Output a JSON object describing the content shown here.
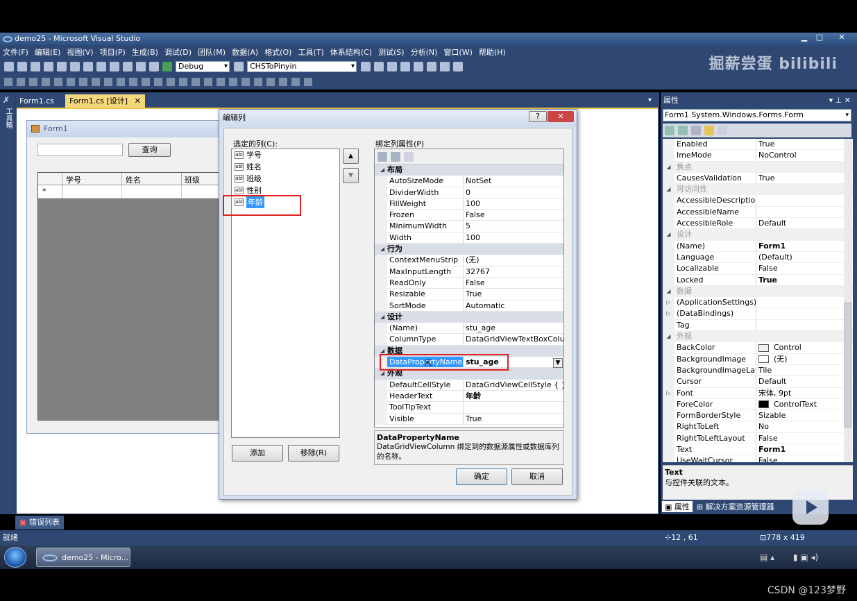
{
  "window": {
    "title": "demo25 - Microsoft Visual Studio",
    "btn_min": "▁",
    "btn_max": "□",
    "btn_close": "✕"
  },
  "menu": [
    "文件(F)",
    "编辑(E)",
    "视图(V)",
    "项目(P)",
    "生成(B)",
    "调试(D)",
    "团队(M)",
    "数据(A)",
    "格式(O)",
    "工具(T)",
    "体系结构(C)",
    "测试(S)",
    "分析(N)",
    "窗口(W)",
    "帮助(H)"
  ],
  "toolbar": {
    "config": "Debug",
    "startup": "CHSToPinyin"
  },
  "watermark": "掘薪尝蛋 bilibili",
  "left_strip": "工具箱",
  "tabs": {
    "tab1": "Form1.cs",
    "tab2": "Form1.cs [设计]",
    "close": "✕",
    "dropdown": "▾"
  },
  "form": {
    "title": "Form1",
    "query_button": "查询",
    "columns": [
      "学号",
      "姓名",
      "班级"
    ],
    "new_row": "*"
  },
  "dialog": {
    "title": "编辑列",
    "help": "?",
    "close": "✕",
    "selected_label": "选定的列(C):",
    "columns": [
      "学号",
      "姓名",
      "班级",
      "性别",
      "年龄"
    ],
    "col_icon": "abl",
    "up": "▲",
    "down": "▼",
    "bound_label": "绑定列属性(P)",
    "add_button": "添加",
    "remove_button": "移除(R)",
    "ok_button": "确定",
    "cancel_button": "取消",
    "desc_title": "DataPropertyName",
    "desc_text": "DataGridViewColumn 绑定到的数据源属性或数据库列的名称。",
    "categories": [
      {
        "name": "布局",
        "rows": [
          [
            "AutoSizeMode",
            "NotSet"
          ],
          [
            "DividerWidth",
            "0"
          ],
          [
            "FillWeight",
            "100"
          ],
          [
            "Frozen",
            "False"
          ],
          [
            "MinimumWidth",
            "5"
          ],
          [
            "Width",
            "100"
          ]
        ]
      },
      {
        "name": "行为",
        "rows": [
          [
            "ContextMenuStrip",
            "(无)"
          ],
          [
            "MaxInputLength",
            "32767"
          ],
          [
            "ReadOnly",
            "False"
          ],
          [
            "Resizable",
            "True"
          ],
          [
            "SortMode",
            "Automatic"
          ]
        ]
      },
      {
        "name": "设计",
        "rows": [
          [
            "(Name)",
            "stu_age"
          ],
          [
            "ColumnType",
            "DataGridViewTextBoxColumn"
          ]
        ]
      },
      {
        "name": "数据",
        "rows": [
          [
            "DataPropertyName",
            "stu_age"
          ]
        ]
      },
      {
        "name": "外观",
        "rows": [
          [
            "DefaultCellStyle",
            "DataGridViewCellStyle { }"
          ],
          [
            "HeaderText",
            "年龄"
          ],
          [
            "ToolTipText",
            ""
          ],
          [
            "Visible",
            "True"
          ]
        ]
      }
    ]
  },
  "properties": {
    "title": "属性",
    "pin": "▾ ⊥ ✕",
    "object": "Form1 System.Windows.Forms.Form",
    "rows": [
      {
        "t": "r",
        "n": "Enabled",
        "v": "True"
      },
      {
        "t": "r",
        "n": "ImeMode",
        "v": "NoControl"
      },
      {
        "t": "c",
        "n": "焦点"
      },
      {
        "t": "r",
        "n": "CausesValidation",
        "v": "True"
      },
      {
        "t": "c",
        "n": "可访问性"
      },
      {
        "t": "r",
        "n": "AccessibleDescription",
        "v": ""
      },
      {
        "t": "r",
        "n": "AccessibleName",
        "v": ""
      },
      {
        "t": "r",
        "n": "AccessibleRole",
        "v": "Default"
      },
      {
        "t": "c",
        "n": "设计"
      },
      {
        "t": "r",
        "n": "(Name)",
        "v": "Form1",
        "b": true
      },
      {
        "t": "r",
        "n": "Language",
        "v": "(Default)"
      },
      {
        "t": "r",
        "n": "Localizable",
        "v": "False"
      },
      {
        "t": "r",
        "n": "Locked",
        "v": "True",
        "b": true
      },
      {
        "t": "c",
        "n": "数据"
      },
      {
        "t": "e",
        "n": "(ApplicationSettings)",
        "v": ""
      },
      {
        "t": "e",
        "n": "(DataBindings)",
        "v": ""
      },
      {
        "t": "r",
        "n": "Tag",
        "v": ""
      },
      {
        "t": "c",
        "n": "外观"
      },
      {
        "t": "r",
        "n": "BackColor",
        "v": "Control",
        "sw": "#f0f0f0"
      },
      {
        "t": "r",
        "n": "BackgroundImage",
        "v": "(无)",
        "sw": "#ffffff"
      },
      {
        "t": "r",
        "n": "BackgroundImageLayout",
        "v": "Tile"
      },
      {
        "t": "r",
        "n": "Cursor",
        "v": "Default"
      },
      {
        "t": "e",
        "n": "Font",
        "v": "宋体, 9pt"
      },
      {
        "t": "r",
        "n": "ForeColor",
        "v": "ControlText",
        "sw": "#000000"
      },
      {
        "t": "r",
        "n": "FormBorderStyle",
        "v": "Sizable"
      },
      {
        "t": "r",
        "n": "RightToLeft",
        "v": "No"
      },
      {
        "t": "r",
        "n": "RightToLeftLayout",
        "v": "False"
      },
      {
        "t": "r",
        "n": "Text",
        "v": "Form1",
        "b": true
      },
      {
        "t": "r",
        "n": "UseWaitCursor",
        "v": "False"
      }
    ],
    "desc_title": "Text",
    "desc_text": "与控件关联的文本。",
    "tab_props": "属性",
    "tab_solution": "解决方案资源管理器"
  },
  "error_list": "错误列表",
  "status": {
    "ready": "就绪",
    "position": "12 , 61",
    "size": "778 x 419"
  },
  "taskbar": {
    "item": "demo25 - Micro..."
  },
  "csdn": "CSDN @123梦野"
}
